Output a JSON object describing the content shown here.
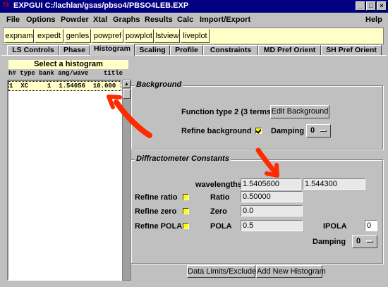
{
  "window": {
    "app_icon": "Tk",
    "title": "EXPGUI C:/lachlan/gsas/pbso4/PBSO4LEB.EXP"
  },
  "menubar": [
    "File",
    "Options",
    "Powder",
    "Xtal",
    "Graphs",
    "Results",
    "Calc",
    "Import/Export"
  ],
  "help_label": "Help",
  "toolbar": [
    "expnam",
    "expedt",
    "genles",
    "powpref",
    "powplot",
    "lstview",
    "liveplot"
  ],
  "tabs": [
    "LS Controls",
    "Phase",
    "Histogram",
    "Scaling",
    "Profile",
    "Constraints",
    "MD Pref Orient",
    "SH Pref Orient"
  ],
  "active_tab": "Histogram",
  "histogram_list": {
    "header": "Select a histogram",
    "columns": "h# type bank ang/wave    title",
    "rows": [
      "1  XC     1  1.54056  10.000  C"
    ]
  },
  "background": {
    "title": "Background",
    "function_text": "Function type 2  (3 terms)",
    "edit_button": "Edit Background",
    "refine_label": "Refine background",
    "refine_checked": true,
    "damping_label": "Damping",
    "damping_value": "0"
  },
  "diffractometer": {
    "title": "Diffractometer Constants",
    "wavelengths_label": "wavelengths",
    "wavelength1": "1.5405600",
    "wavelength2": "1.544300",
    "refine_ratio_label": "Refine ratio",
    "ratio_label": "Ratio",
    "ratio_value": "0.50000",
    "refine_zero_label": "Refine zero",
    "zero_label": "Zero",
    "zero_value": "0.0",
    "refine_pola_label": "Refine POLA",
    "pola_label": "POLA",
    "pola_value": "0.5",
    "ipola_label": "IPOLA",
    "ipola_value": "0",
    "damping_label": "Damping",
    "damping_value": "0"
  },
  "bottom_buttons": {
    "data_limits": "Data Limits/Exclude",
    "add_histogram": "Add New Histogram"
  },
  "colors": {
    "title_bar": "#000080",
    "toolbar_bg": "#ffffc6",
    "checkbox": "#ffff00",
    "annotation_arrow": "#ff2a00"
  }
}
